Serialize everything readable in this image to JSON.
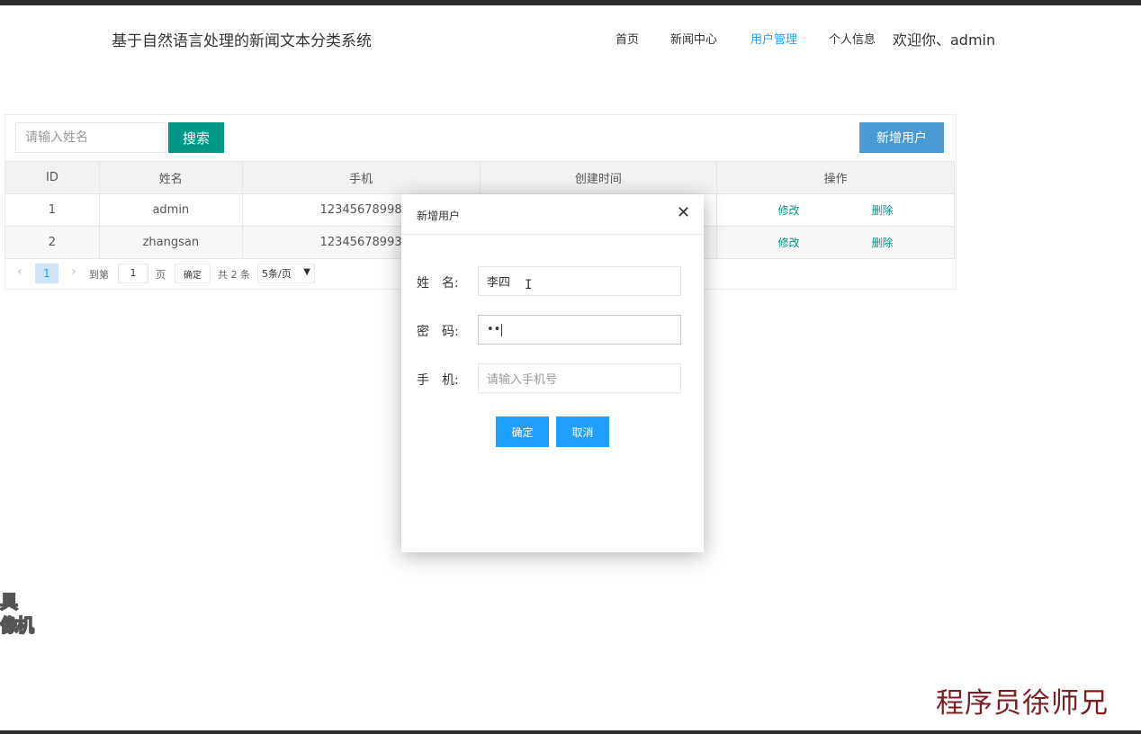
{
  "header": {
    "site_title": "基于自然语言处理的新闻文本分类系统",
    "nav": [
      {
        "label": "首页",
        "active": false
      },
      {
        "label": "新闻中心",
        "active": false
      },
      {
        "label": "用户管理",
        "active": true
      },
      {
        "label": "个人信息",
        "active": false
      }
    ],
    "welcome": "欢迎你、admin"
  },
  "toolbar": {
    "search_placeholder": "请输入姓名",
    "search_label": "搜索",
    "add_label": "新增用户"
  },
  "table": {
    "columns": [
      "ID",
      "姓名",
      "手机",
      "创建时间",
      "操作"
    ],
    "rows": [
      {
        "id": "1",
        "name": "admin",
        "phone": "12345678998",
        "created": "",
        "edit": "修改",
        "delete": "删除"
      },
      {
        "id": "2",
        "name": "zhangsan",
        "phone": "12345678993",
        "created": "",
        "edit": "修改",
        "delete": "删除"
      }
    ]
  },
  "pager": {
    "prev_icon": "chevron-left-icon",
    "next_icon": "chevron-right-icon",
    "current": "1",
    "goto_label": "到第",
    "goto_value": "1",
    "page_label": "页",
    "confirm_label": "确定",
    "total_label": "共 2 条",
    "page_size": "5条/页"
  },
  "dialog": {
    "title": "新增用户",
    "close_icon": "close-icon",
    "fields": [
      {
        "label": "姓　名:",
        "value": "李四",
        "placeholder": ""
      },
      {
        "label": "密　码:",
        "value": "••",
        "placeholder": ""
      },
      {
        "label": "手　机:",
        "value": "",
        "placeholder": "请输入手机号"
      }
    ],
    "ok_label": "确定",
    "cancel_label": "取消"
  },
  "watermark": {
    "left_text_1": "具",
    "left_text_2": "像机",
    "signature": "程序员徐师兄"
  },
  "colors": {
    "teal": "#009688",
    "blue": "#1e9fff",
    "add_blue": "#4a9ad4"
  }
}
